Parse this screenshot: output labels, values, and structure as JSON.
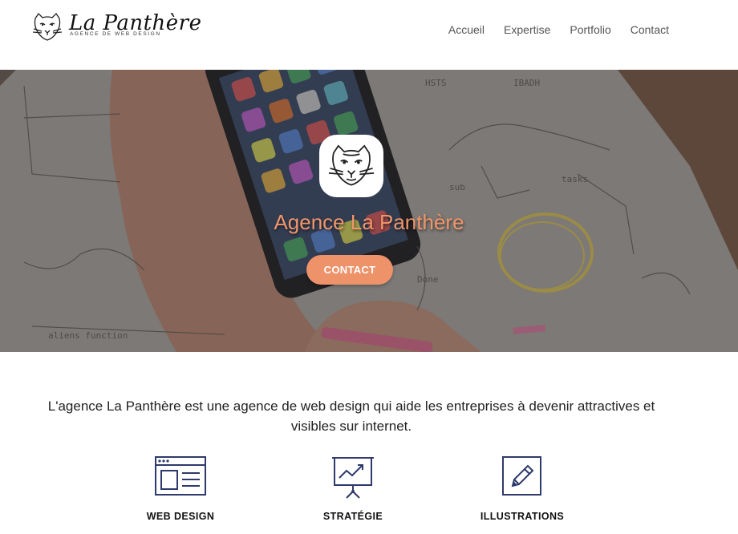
{
  "brand": {
    "name": "La Panthère",
    "tagline": "AGENCE DE WEB DESIGN",
    "logo_icon": "panther-head-icon"
  },
  "nav": {
    "items": [
      {
        "label": "Accueil"
      },
      {
        "label": "Expertise"
      },
      {
        "label": "Portfolio"
      },
      {
        "label": "Contact"
      }
    ]
  },
  "hero": {
    "title": "Agence La Panthère",
    "button_label": "CONTACT",
    "accent_color": "#ee926a"
  },
  "intro": {
    "text": "L'agence La Panthère est une agence de web design qui aide les entreprises à devenir attractives et visibles sur internet."
  },
  "services": [
    {
      "label": "WEB DESIGN",
      "icon": "browser-window-icon"
    },
    {
      "label": "STRATÉGIE",
      "icon": "presentation-chart-icon"
    },
    {
      "label": "ILLUSTRATIONS",
      "icon": "pencil-icon"
    }
  ],
  "colors": {
    "icon_stroke": "#2e3a6b",
    "nav_text": "#555555"
  }
}
